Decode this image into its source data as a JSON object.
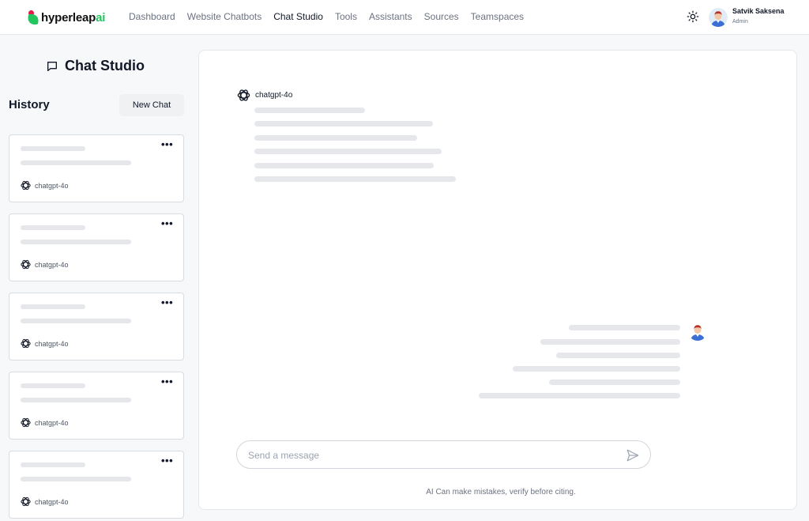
{
  "brand": {
    "name_main": "hyperleap",
    "name_accent": "ai",
    "accent_color": "#22c55e",
    "dot_color": "#e11d48"
  },
  "nav": {
    "items": [
      {
        "label": "Dashboard",
        "active": false
      },
      {
        "label": "Website Chatbots",
        "active": false
      },
      {
        "label": "Chat Studio",
        "active": true
      },
      {
        "label": "Tools",
        "active": false
      },
      {
        "label": "Assistants",
        "active": false
      },
      {
        "label": "Sources",
        "active": false
      },
      {
        "label": "Teamspaces",
        "active": false
      }
    ]
  },
  "header": {
    "theme_icon": "sun-icon"
  },
  "user": {
    "name": "Satvik Saksena",
    "role": "Admin"
  },
  "studio": {
    "title": "Chat Studio",
    "icon": "chat-bubble-icon"
  },
  "history": {
    "label": "History",
    "new_chat_label": "New Chat",
    "items": [
      {
        "model": "chatgpt-4o"
      },
      {
        "model": "chatgpt-4o"
      },
      {
        "model": "chatgpt-4o"
      },
      {
        "model": "chatgpt-4o"
      },
      {
        "model": "chatgpt-4o"
      }
    ]
  },
  "chat": {
    "bot_model": "chatgpt-4o",
    "input_placeholder": "Send a message",
    "send_icon": "send-icon",
    "disclaimer": "AI Can make mistakes, verify before citing."
  }
}
